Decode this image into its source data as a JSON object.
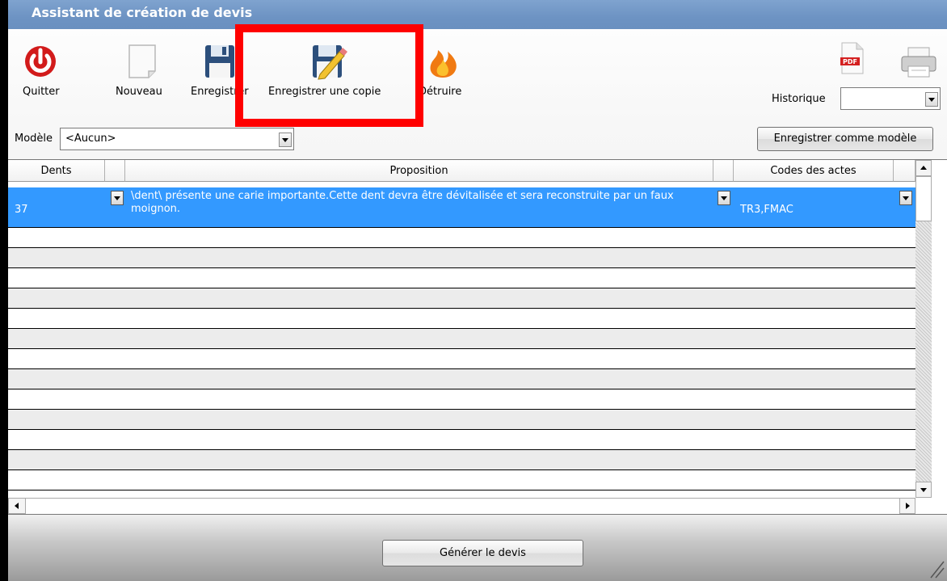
{
  "window": {
    "title": "Assistant de création de devis"
  },
  "toolbar": {
    "quit": "Quitter",
    "new": "Nouveau",
    "save": "Enregistrer",
    "save_copy": "Enregistrer une copie",
    "destroy": "Détruire",
    "history_label": "Historique",
    "history_value": ""
  },
  "model_bar": {
    "label": "Modèle",
    "value": "<Aucun>",
    "save_as_model": "Enregistrer comme modèle"
  },
  "grid": {
    "headers": {
      "teeth": "Dents",
      "proposal": "Proposition",
      "codes": "Codes des actes"
    },
    "rows": [
      {
        "teeth": "37",
        "proposal": "\\dent\\ présente une carie importante.Cette dent devra être dévitalisée et sera reconstruite par un faux moignon.",
        "codes": "TR3,FMAC"
      }
    ]
  },
  "footer": {
    "generate": "Générer le devis"
  },
  "colors": {
    "title_bar": "#6f95c4",
    "selection": "#3399ff",
    "highlight": "#ff0000"
  }
}
